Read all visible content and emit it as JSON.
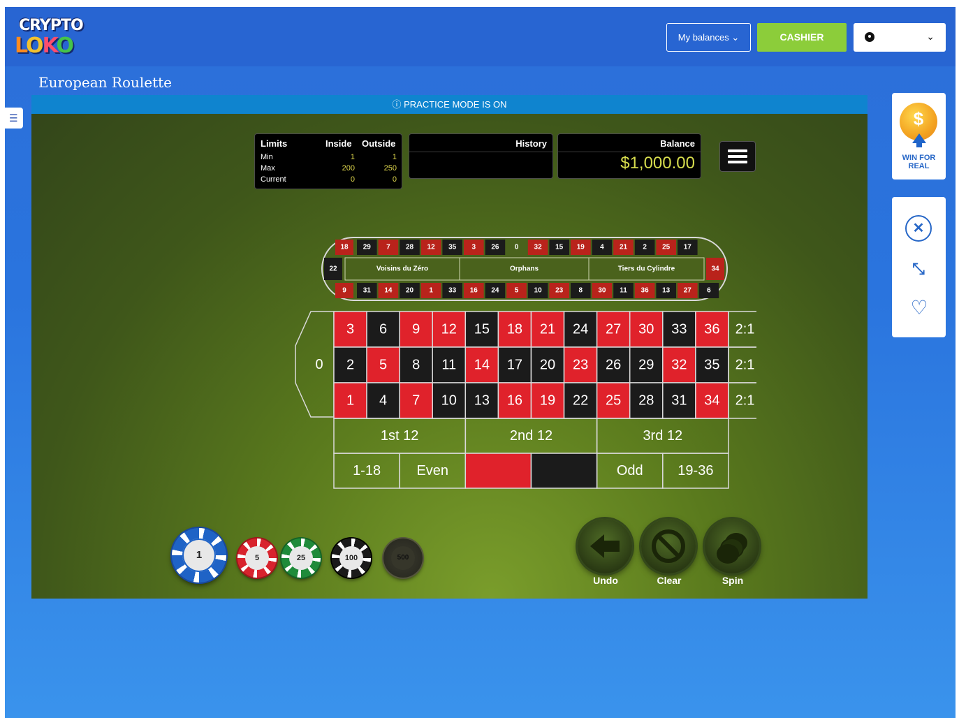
{
  "header": {
    "logo_line1": "CRYPTO",
    "logo_line2": [
      "L",
      "O",
      "K",
      "O"
    ],
    "balances_label": "My balances ⌄",
    "cashier_label": "CASHIER",
    "account_chevron": "⌄"
  },
  "game": {
    "title": "European Roulette",
    "practice_notice": "ⓘ PRACTICE MODE IS ON",
    "limits": {
      "title": "Limits",
      "col_inside": "Inside",
      "col_outside": "Outside",
      "rows": [
        {
          "label": "Min",
          "inside": "1",
          "outside": "1"
        },
        {
          "label": "Max",
          "inside": "200",
          "outside": "250"
        },
        {
          "label": "Current",
          "inside": "0",
          "outside": "0"
        }
      ]
    },
    "history_title": "History",
    "balance_title": "Balance",
    "balance_amount": "$1,000.00",
    "racetrack": {
      "top": [
        "18",
        "29",
        "7",
        "28",
        "12",
        "35",
        "3",
        "26",
        "0",
        "32",
        "15",
        "19",
        "4",
        "21",
        "2",
        "25",
        "17"
      ],
      "bottom": [
        "9",
        "31",
        "14",
        "20",
        "1",
        "33",
        "16",
        "24",
        "5",
        "10",
        "23",
        "8",
        "30",
        "11",
        "36",
        "13",
        "27",
        "6"
      ],
      "left": "22",
      "right": "34",
      "sections": [
        "Voisins du Zéro",
        "Orphans",
        "Tiers du Cylindre"
      ]
    },
    "board": {
      "zero": "0",
      "rows": [
        [
          "3",
          "6",
          "9",
          "12",
          "15",
          "18",
          "21",
          "24",
          "27",
          "30",
          "33",
          "36"
        ],
        [
          "2",
          "5",
          "8",
          "11",
          "14",
          "17",
          "20",
          "23",
          "26",
          "29",
          "32",
          "35"
        ],
        [
          "1",
          "4",
          "7",
          "10",
          "13",
          "16",
          "19",
          "22",
          "25",
          "28",
          "31",
          "34"
        ]
      ],
      "red_numbers": [
        "1",
        "3",
        "5",
        "7",
        "9",
        "12",
        "14",
        "16",
        "18",
        "19",
        "21",
        "23",
        "25",
        "27",
        "30",
        "32",
        "34",
        "36"
      ],
      "column_bets": [
        "2:1",
        "2:1",
        "2:1"
      ],
      "dozens": [
        "1st 12",
        "2nd 12",
        "3rd 12"
      ],
      "outside": [
        "1-18",
        "Even",
        "",
        "",
        "Odd",
        "19-36"
      ]
    },
    "chips": [
      "1",
      "5",
      "25",
      "100",
      "500"
    ],
    "actions": {
      "undo": "Undo",
      "clear": "Clear",
      "spin": "Spin"
    }
  },
  "sidebar": {
    "win_for_real": "WIN FOR REAL",
    "coin_symbol": "$",
    "close_icon": "✕",
    "expand_icon": "⤡",
    "heart_icon": "♡"
  },
  "colors": {
    "red": "#e0222b",
    "black": "#1b1b1b",
    "green_felt": "#5a7a1d",
    "accent_blue": "#2767c7",
    "cashier_green": "#8ccd3a"
  }
}
